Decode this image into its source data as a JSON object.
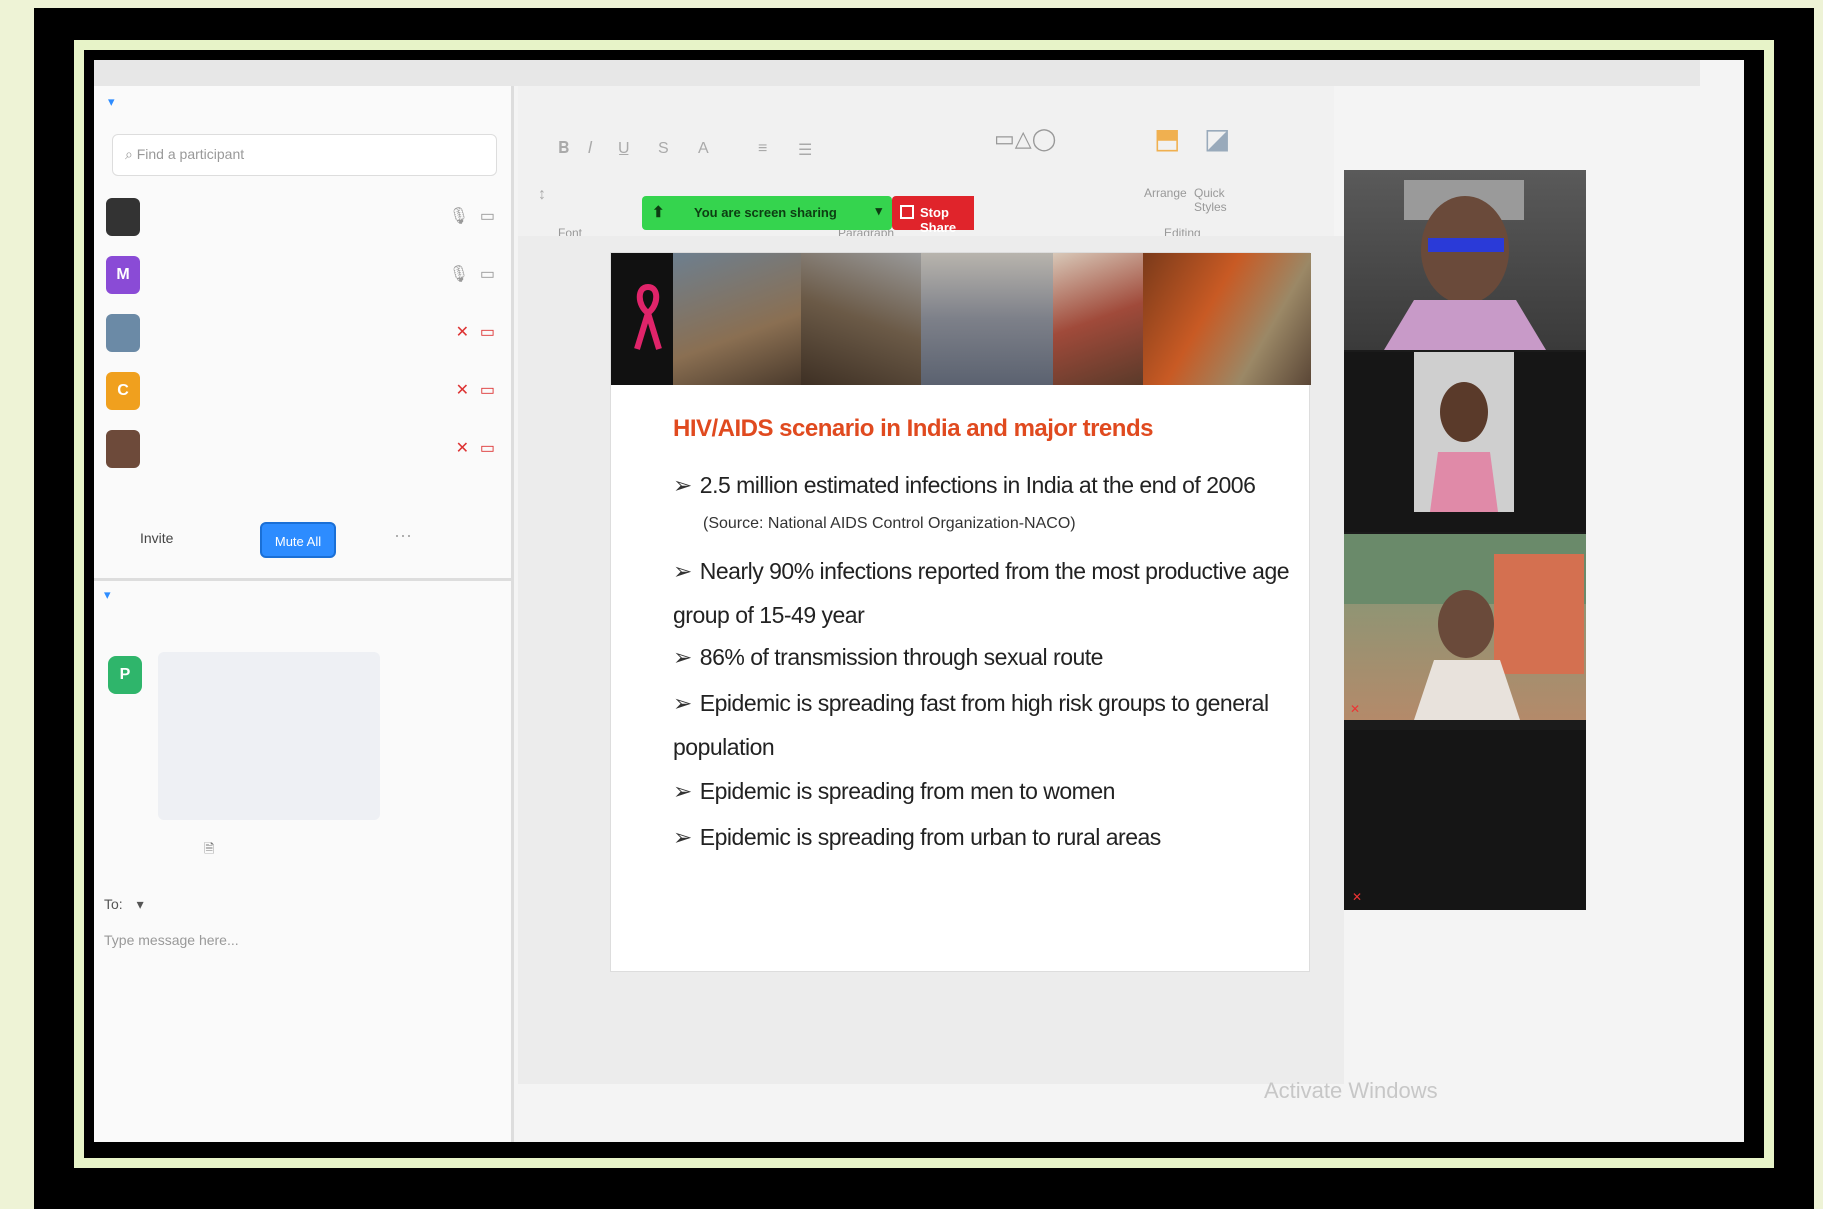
{
  "topbar": {
    "items": [
      "",
      "",
      "",
      "",
      ""
    ]
  },
  "ribbon_tabs": [
    "",
    "",
    "",
    ""
  ],
  "ribbon_groups": {
    "font": "Font",
    "paragraph": "Paragraph",
    "editing": "Editing"
  },
  "right_ribbon": {
    "styles": "",
    "arrange": "Arrange",
    "quick": "Quick Styles"
  },
  "participants_panel": {
    "title": "",
    "search_placeholder": "Find a participant",
    "participants": [
      {
        "initial": "",
        "name": "",
        "color": "#333333",
        "mic_muted": false
      },
      {
        "initial": "M",
        "name": "",
        "color": "#8a4bd6",
        "mic_muted": false
      },
      {
        "initial": "",
        "name": "",
        "color": "#6b8aa6",
        "mic_muted": true
      },
      {
        "initial": "C",
        "name": "",
        "color": "#f0a01e",
        "mic_muted": true
      },
      {
        "initial": "",
        "name": "",
        "color": "#6d4a3a",
        "mic_muted": true
      }
    ],
    "invite_label": "Invite",
    "mute_all_label": "Mute All"
  },
  "share_toolbar": {
    "status_label": "You are screen sharing",
    "stop_label": "Stop Share"
  },
  "chat": {
    "header": "",
    "sender": "",
    "avatar_initial": "P",
    "message_lines": [
      "",
      "",
      "",
      "",
      ""
    ],
    "file_hint": "",
    "to_label": "To:",
    "to_target": "",
    "to_tag": "",
    "input_placeholder": "Type message here..."
  },
  "slide": {
    "title": "HIV/AIDS scenario in India and major trends",
    "bullets": [
      "2.5 million estimated infections in India at the end of 2006",
      "Nearly 90% infections reported from the most productive age group of 15-49 year",
      "86% of transmission through sexual route",
      "Epidemic is spreading fast from high risk groups to general population",
      "Epidemic is spreading from men to women",
      "Epidemic is spreading from urban to rural areas"
    ],
    "source": "(Source: National AIDS Control Organization-NACO)",
    "footnote_text": "",
    "footnote_link": ""
  },
  "videos": [
    {
      "caption": ""
    },
    {
      "caption": ""
    },
    {
      "caption": ""
    }
  ],
  "name_tile": {
    "name": "",
    "caption": ""
  },
  "watermark": {
    "title": "Activate Windows",
    "subtitle": ""
  }
}
